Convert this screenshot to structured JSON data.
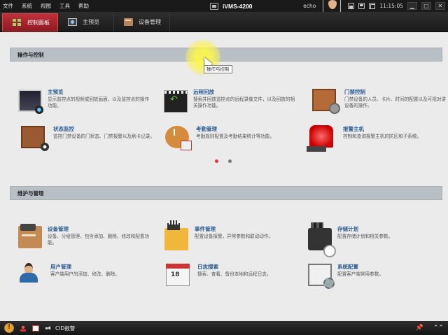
{
  "menu": [
    "文件",
    "系统",
    "视图",
    "工具",
    "帮助"
  ],
  "app_title": "iVMS-4200",
  "titlebar": {
    "user": "echo",
    "time": "11:15:05",
    "minimize": "▁",
    "maximize": "□",
    "close": "✕"
  },
  "tabs": [
    {
      "label": "控制面板",
      "icon": "control-panel-icon",
      "active": true
    },
    {
      "label": "主预览",
      "icon": "main-view-icon",
      "active": false
    },
    {
      "label": "设备管理",
      "icon": "device-management-icon",
      "active": false
    }
  ],
  "sections": {
    "operation": {
      "title": "操作与控制",
      "items": [
        {
          "title": "主预览",
          "desc": "显示监控点的视频或回放画面，以及监控点的操作功能。",
          "icon": "main-view-icon"
        },
        {
          "title": "远程回放",
          "desc": "搜索并回放监控点的远程录像文件，以及回放的相关操作功能。",
          "icon": "remote-playback-icon"
        },
        {
          "title": "门禁控制",
          "desc": "门禁设备的人员、卡片、时间的配置以及可视对讲设备的操作。",
          "icon": "access-control-icon"
        },
        {
          "title": "状态监控",
          "desc": "监控门禁设备的门状态、门禁报警以及刷卡记录。",
          "icon": "status-monitor-icon"
        },
        {
          "title": "考勤管理",
          "desc": "考勤规则配置及考勤结果统计等功能。",
          "icon": "attendance-icon"
        },
        {
          "title": "报警主机",
          "desc": "控制和查询报警主机的防区和子系统。",
          "icon": "alarm-host-icon"
        }
      ]
    },
    "maintenance": {
      "title": "维护与管理",
      "items": [
        {
          "title": "设备管理",
          "desc": "设备、分组管理，包含添加、删除、修改和配置功能。",
          "icon": "device-management-icon"
        },
        {
          "title": "事件管理",
          "desc": "配置设备报警，异常参数和联动动作。",
          "icon": "event-management-icon"
        },
        {
          "title": "存储计划",
          "desc": "配置存储计划和相关参数。",
          "icon": "storage-schedule-icon"
        },
        {
          "title": "用户管理",
          "desc": "客户端用户的添加、修改、删除。",
          "icon": "user-management-icon"
        },
        {
          "title": "日志搜索",
          "desc": "搜索、查看、备份本地和远程日志。",
          "icon": "log-search-icon"
        },
        {
          "title": "系统配置",
          "desc": "配置客户端常用参数。",
          "icon": "system-config-icon"
        }
      ]
    }
  },
  "pagination": {
    "pages": 2,
    "current": 1
  },
  "tooltip": "操作与控制",
  "statusbar": {
    "cid_label": "CID报警",
    "pin": "📌",
    "more_up": "⌃⌃"
  },
  "colors": {
    "active_tab": "#b5262f",
    "item_title": "#2c5b8f",
    "section_header_bg": "#b8c0c6",
    "content_bg": "#ebebeb"
  }
}
